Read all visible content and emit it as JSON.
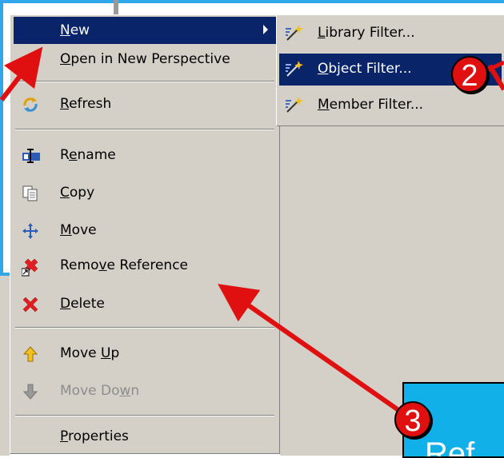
{
  "menu": {
    "items": [
      {
        "id": "new",
        "pre": "",
        "ul": "N",
        "post": "ew",
        "icon": "none",
        "highlighted": true,
        "submenu": true
      },
      {
        "id": "open-perspective",
        "pre": "",
        "ul": "O",
        "post": "pen in New Perspective",
        "icon": "none"
      },
      {
        "id": "refresh",
        "pre": "",
        "ul": "R",
        "post": "efresh",
        "icon": "refresh-icon"
      },
      {
        "id": "rename",
        "pre": "R",
        "ul": "e",
        "post": "name",
        "icon": "rename-icon"
      },
      {
        "id": "copy",
        "pre": "",
        "ul": "C",
        "post": "opy",
        "icon": "copy-icon"
      },
      {
        "id": "move",
        "pre": "",
        "ul": "M",
        "post": "ove",
        "icon": "move-icon"
      },
      {
        "id": "remove-reference",
        "pre": "Remo",
        "ul": "v",
        "post": "e Reference",
        "icon": "remove-reference-icon"
      },
      {
        "id": "delete",
        "pre": "",
        "ul": "D",
        "post": "elete",
        "icon": "delete-icon"
      },
      {
        "id": "move-up",
        "pre": "Move ",
        "ul": "U",
        "post": "p",
        "icon": "arrow-up-icon"
      },
      {
        "id": "move-down",
        "pre": "Move Do",
        "ul": "w",
        "post": "n",
        "icon": "arrow-down-icon",
        "disabled": true
      },
      {
        "id": "properties",
        "pre": "",
        "ul": "P",
        "post": "roperties",
        "icon": "none"
      }
    ]
  },
  "submenu": {
    "items": [
      {
        "id": "library-filter",
        "pre": "",
        "ul": "L",
        "post": "ibrary Filter...",
        "icon": "filter-wand-icon"
      },
      {
        "id": "object-filter",
        "pre": "",
        "ul": "O",
        "post": "bject Filter...",
        "icon": "filter-wand-icon",
        "highlighted": true
      },
      {
        "id": "member-filter",
        "pre": "",
        "ul": "M",
        "post": "ember Filter...",
        "icon": "filter-wand-icon"
      }
    ]
  },
  "callouts": {
    "badge2": "2",
    "badge3": "3",
    "box_text": "Ref"
  },
  "colors": {
    "highlight": "#0a246a",
    "menu_bg": "#d4d0c8",
    "arrow": "#e01010",
    "callout_bg": "#12b0e8"
  }
}
